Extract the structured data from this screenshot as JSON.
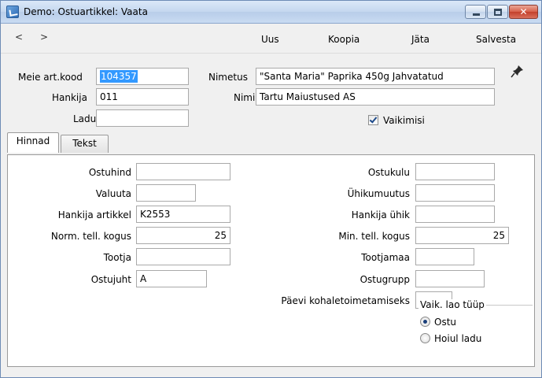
{
  "window": {
    "title": "Demo: Ostuartikkel: Vaata"
  },
  "toolbar": {
    "back": "<",
    "forward": ">",
    "new_label": "Uus",
    "copy_label": "Koopia",
    "leave_label": "Jäta",
    "save_label": "Salvesta"
  },
  "header": {
    "our_code_label": "Meie art.kood",
    "our_code_value": "104357",
    "supplier_label": "Hankija",
    "supplier_value": "011",
    "location_label": "Ladu",
    "location_value": "",
    "name_label": "Nimetus",
    "name_value": "\"Santa Maria\" Paprika  450g  Jahvatatud",
    "supplier_name_label": "Nimi",
    "supplier_name_value": "Tartu Maiustused AS",
    "default_label": "Vaikimisi",
    "default_checked": true
  },
  "tabs": [
    {
      "label": "Hinnad",
      "active": true
    },
    {
      "label": "Tekst",
      "active": false
    }
  ],
  "prices": {
    "purchase_price_label": "Ostuhind",
    "purchase_price_value": "",
    "currency_label": "Valuuta",
    "currency_value": "",
    "supplier_item_label": "Hankija artikkel",
    "supplier_item_value": "K2553",
    "norm_qty_label": "Norm. tell. kogus",
    "norm_qty_value": "25",
    "producer_label": "Tootja",
    "producer_value": "",
    "buyer_label": "Ostujuht",
    "buyer_value": "A",
    "purchase_cost_label": "Ostukulu",
    "purchase_cost_value": "",
    "unit_coef_label": "Ühikumuutus",
    "unit_coef_value": "",
    "supplier_unit_label": "Hankija ühik",
    "supplier_unit_value": "",
    "min_qty_label": "Min. tell. kogus",
    "min_qty_value": "25",
    "country_label": "Tootjamaa",
    "country_value": "",
    "purchase_group_label": "Ostugrupp",
    "purchase_group_value": "",
    "delivery_days_label": "Päevi kohaletoimetamiseks",
    "delivery_days_value": "",
    "stock_type_label": "Vaik. lao tüüp",
    "stock_options": [
      {
        "label": "Ostu",
        "selected": true
      },
      {
        "label": "Hoiul ladu",
        "selected": false
      }
    ]
  }
}
